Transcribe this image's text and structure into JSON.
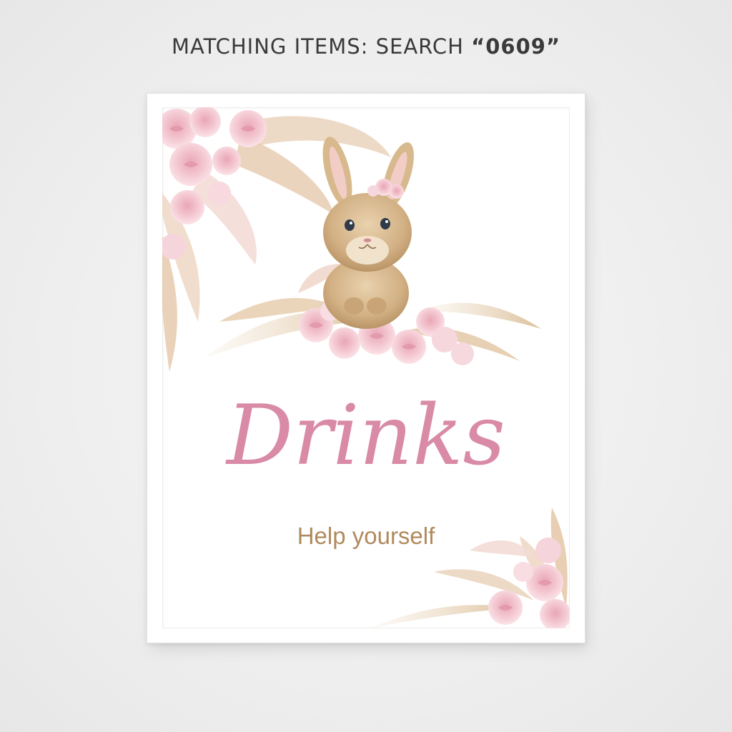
{
  "header": {
    "prefix": "MATCHING ITEMS: SEARCH ",
    "code": "“0609”"
  },
  "sign": {
    "title": "Drinks",
    "subtitle": "Help yourself"
  },
  "colors": {
    "title": "#d98aa6",
    "subtitle": "#b08a5e",
    "wall": "#eeeeee",
    "frame": "#ffffff",
    "rose": "#f2c4cf",
    "pampas": "#e8d3b8"
  },
  "illustration": {
    "subject": "bunny-with-pink-roses-and-pampas-grass"
  }
}
